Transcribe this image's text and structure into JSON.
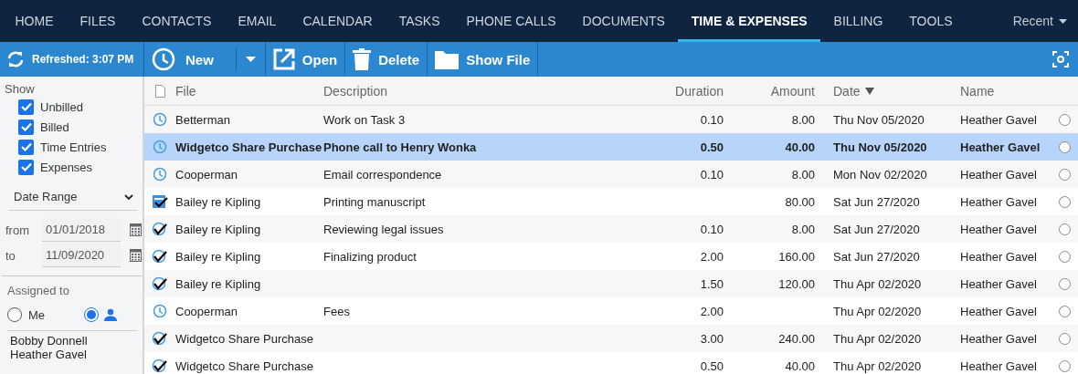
{
  "nav": {
    "tabs": [
      {
        "label": "HOME",
        "selected": false
      },
      {
        "label": "FILES",
        "selected": false
      },
      {
        "label": "CONTACTS",
        "selected": false
      },
      {
        "label": "EMAIL",
        "selected": false
      },
      {
        "label": "CALENDAR",
        "selected": false
      },
      {
        "label": "TASKS",
        "selected": false
      },
      {
        "label": "PHONE CALLS",
        "selected": false
      },
      {
        "label": "DOCUMENTS",
        "selected": false
      },
      {
        "label": "TIME & EXPENSES",
        "selected": true
      },
      {
        "label": "BILLING",
        "selected": false
      },
      {
        "label": "TOOLS",
        "selected": false
      }
    ],
    "recent": "Recent"
  },
  "toolbar": {
    "refreshed": "Refreshed: 3:07 PM",
    "buttons": [
      {
        "kind": "new",
        "label": "New"
      },
      {
        "kind": "open",
        "label": "Open"
      },
      {
        "kind": "delete",
        "label": "Delete"
      },
      {
        "kind": "showfile",
        "label": "Show File"
      }
    ]
  },
  "sidebar": {
    "show_label": "Show",
    "filters": [
      {
        "label": "Unbilled",
        "checked": true
      },
      {
        "label": "Billed",
        "checked": true
      },
      {
        "label": "Time Entries",
        "checked": true
      },
      {
        "label": "Expenses",
        "checked": true
      }
    ],
    "range": "Date Range",
    "from_label": "from",
    "from": "01/01/2018",
    "to_label": "to",
    "to": "11/09/2020",
    "assigned_label": "Assigned to",
    "assign_options": [
      {
        "kind": "me",
        "label": "Me",
        "selected": false
      },
      {
        "kind": "person",
        "selected": true
      }
    ],
    "people": [
      "Bobby Donnell",
      "Heather Gavel"
    ]
  },
  "table": {
    "columns": [
      "File",
      "Description",
      "Duration",
      "Amount",
      "Date",
      "Name"
    ],
    "rows": [
      {
        "kind": "time",
        "file": "Betterman",
        "description": "Work on Task 3",
        "duration": "0.10",
        "amount": "8.00",
        "date": "Thu Nov 05/2020",
        "name": "Heather Gavel",
        "selected": false
      },
      {
        "kind": "time",
        "file": "Widgetco Share Purchase",
        "description": "Phone call to Henry Wonka",
        "duration": "0.50",
        "amount": "40.00",
        "date": "Thu Nov 05/2020",
        "name": "Heather Gavel",
        "selected": true
      },
      {
        "kind": "time",
        "file": "Cooperman",
        "description": "Email correspondence",
        "duration": "0.10",
        "amount": "8.00",
        "date": "Mon Nov 02/2020",
        "name": "Heather Gavel",
        "selected": false
      },
      {
        "kind": "expense",
        "file": "Bailey re Kipling",
        "description": "Printing manuscript",
        "amount": "80.00",
        "date": "Sat Jun 27/2020",
        "name": "Heather Gavel",
        "selected": false
      },
      {
        "kind": "billed",
        "file": "Bailey re Kipling",
        "description": "Reviewing legal issues",
        "duration": "0.10",
        "amount": "8.00",
        "date": "Sat Jun 27/2020",
        "name": "Heather Gavel",
        "selected": false
      },
      {
        "kind": "billed",
        "file": "Bailey re Kipling",
        "description": "Finalizing product",
        "duration": "2.00",
        "amount": "160.00",
        "date": "Sat Jun 27/2020",
        "name": "Heather Gavel",
        "selected": false
      },
      {
        "kind": "billed",
        "file": "Bailey re Kipling",
        "duration": "1.50",
        "amount": "120.00",
        "date": "Thu Apr 02/2020",
        "name": "Heather Gavel",
        "selected": false
      },
      {
        "kind": "time",
        "file": "Cooperman",
        "description": "Fees",
        "duration": "2.00",
        "date": "Thu Apr 02/2020",
        "name": "Heather Gavel",
        "selected": false
      },
      {
        "kind": "billed",
        "file": "Widgetco Share Purchase",
        "duration": "3.00",
        "amount": "240.00",
        "date": "Thu Apr 02/2020",
        "name": "Heather Gavel",
        "selected": false
      },
      {
        "kind": "billed",
        "file": "Widgetco Share Purchase",
        "duration": "0.50",
        "amount": "40.00",
        "date": "Thu Apr 02/2020",
        "name": "Heather Gavel",
        "selected": false
      }
    ]
  }
}
